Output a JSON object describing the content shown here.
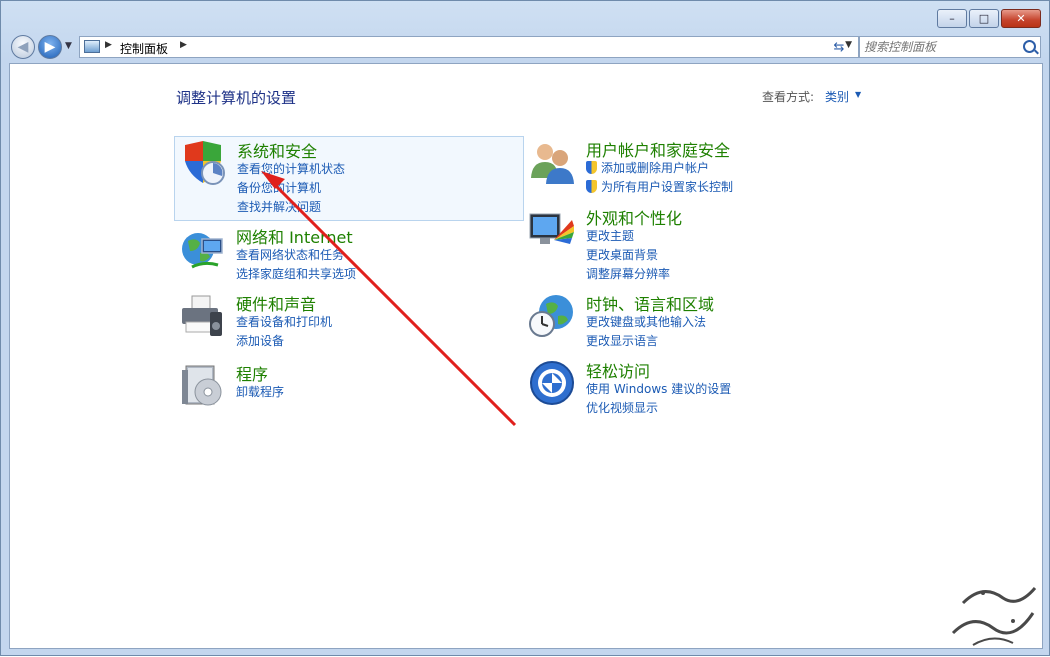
{
  "window": {
    "minimize_label": "–",
    "maximize_label": "□",
    "close_label": "✕"
  },
  "address_bar": {
    "breadcrumb": "控制面板"
  },
  "search": {
    "placeholder": "搜索控制面板"
  },
  "main": {
    "heading": "调整计算机的设置",
    "view_by_label": "查看方式:",
    "view_by_value": "类别"
  },
  "categories": [
    {
      "title": "系统和安全",
      "icon": "security-shield-icon",
      "links": [
        "查看您的计算机状态",
        "备份您的计算机",
        "查找并解决问题"
      ]
    },
    {
      "title": "网络和 Internet",
      "icon": "network-globe-icon",
      "links": [
        "查看网络状态和任务",
        "选择家庭组和共享选项"
      ]
    },
    {
      "title": "硬件和声音",
      "icon": "printer-icon",
      "links": [
        "查看设备和打印机",
        "添加设备"
      ]
    },
    {
      "title": "程序",
      "icon": "programs-disc-icon",
      "links": [
        "卸载程序"
      ]
    },
    {
      "title": "用户帐户和家庭安全",
      "icon": "users-icon",
      "links": [
        "添加或删除用户帐户",
        "为所有用户设置家长控制"
      ]
    },
    {
      "title": "外观和个性化",
      "icon": "display-color-icon",
      "links": [
        "更改主题",
        "更改桌面背景",
        "调整屏幕分辨率"
      ]
    },
    {
      "title": "时钟、语言和区域",
      "icon": "clock-globe-icon",
      "links": [
        "更改键盘或其他输入法",
        "更改显示语言"
      ]
    },
    {
      "title": "轻松访问",
      "icon": "ease-of-access-icon",
      "links": [
        "使用 Windows 建议的设置",
        "优化视频显示"
      ]
    }
  ],
  "colors": {
    "category_title": "#1e8000",
    "link": "#1c5bb4",
    "heading": "#1e3287",
    "annotation_arrow": "#e0201c"
  }
}
